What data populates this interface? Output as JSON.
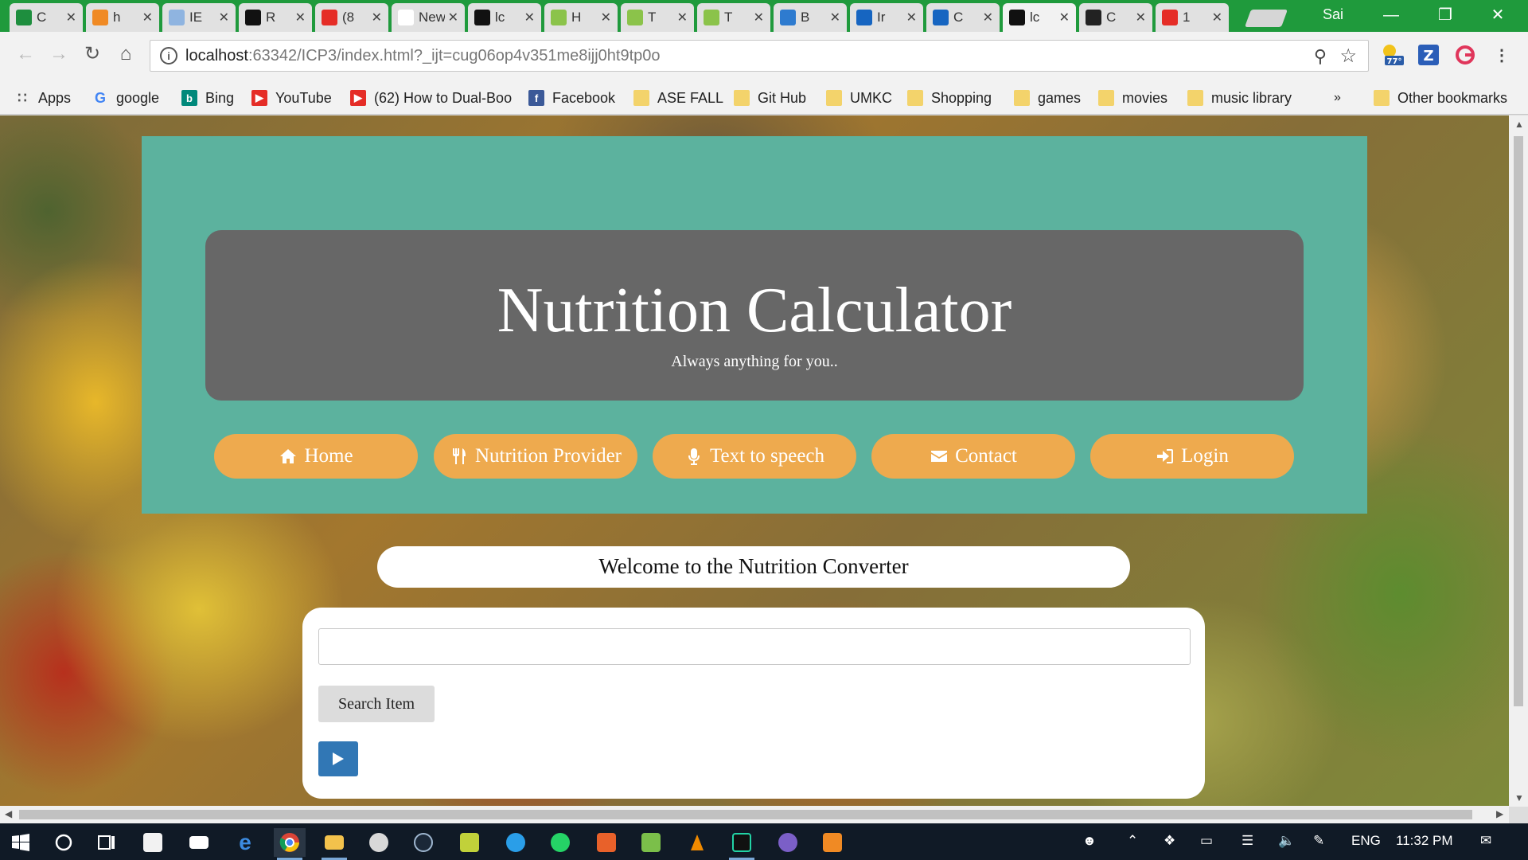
{
  "browser": {
    "tabs": [
      {
        "title": "C",
        "color": "#1e8e3e",
        "icon": "sheets-icon"
      },
      {
        "title": "h",
        "color": "#f08a24",
        "icon": "dots-icon"
      },
      {
        "title": "IE",
        "color": "#8fb4e0",
        "icon": "cloud-icon"
      },
      {
        "title": "R",
        "color": "#111111",
        "icon": "webstorm-icon"
      },
      {
        "title": "(8",
        "color": "#e52d27",
        "icon": "youtube-icon"
      },
      {
        "title": "New",
        "color": "#ffffff",
        "icon": "blank-icon"
      },
      {
        "title": "lc",
        "color": "#111111",
        "icon": "webstorm-icon"
      },
      {
        "title": "H",
        "color": "#8bc34a",
        "icon": "w3-icon"
      },
      {
        "title": "T",
        "color": "#8bc34a",
        "icon": "w3-icon"
      },
      {
        "title": "T",
        "color": "#8bc34a",
        "icon": "w3-icon"
      },
      {
        "title": "B",
        "color": "#2e7bcf",
        "icon": "bootstrap-icon"
      },
      {
        "title": "Ir",
        "color": "#1665c1",
        "icon": "box-icon"
      },
      {
        "title": "C",
        "color": "#1665c1",
        "icon": "box-icon"
      },
      {
        "title": "lc",
        "color": "#111111",
        "icon": "webstorm-icon"
      },
      {
        "title": "C",
        "color": "#222222",
        "icon": "github-icon"
      },
      {
        "title": "1",
        "color": "#e52d27",
        "icon": "youtube-icon"
      }
    ],
    "profile_name": "Sai",
    "url_host": "localhost",
    "url_rest": ":63342/ICP3/index.html?_ijt=cug06op4v351me8ijj0ht9tp0o",
    "weather_badge": "77°",
    "bookmarks": [
      {
        "label": "Apps",
        "icon": "apps-icon"
      },
      {
        "label": "google",
        "icon": "google-icon"
      },
      {
        "label": "Bing",
        "icon": "bing-icon"
      },
      {
        "label": "YouTube",
        "icon": "youtube-icon"
      },
      {
        "label": "(62) How to Dual-Boo",
        "icon": "youtube-icon"
      },
      {
        "label": "Facebook",
        "icon": "facebook-icon"
      },
      {
        "label": "ASE FALL",
        "icon": "folder-icon"
      },
      {
        "label": "Git Hub",
        "icon": "folder-icon"
      },
      {
        "label": "UMKC",
        "icon": "folder-icon"
      },
      {
        "label": "Shopping",
        "icon": "folder-icon"
      },
      {
        "label": "games",
        "icon": "folder-icon"
      },
      {
        "label": "movies",
        "icon": "folder-icon"
      },
      {
        "label": "music library",
        "icon": "folder-icon"
      }
    ],
    "overflow": "»",
    "other_bookmarks": "Other bookmarks"
  },
  "page": {
    "title": "Nutrition Calculator",
    "tagline": "Always anything for you..",
    "nav": [
      {
        "label": "Home",
        "icon": "home-icon"
      },
      {
        "label": "Nutrition Provider",
        "icon": "cutlery-icon"
      },
      {
        "label": "Text to speech",
        "icon": "microphone-icon"
      },
      {
        "label": "Contact",
        "icon": "envelope-icon"
      },
      {
        "label": "Login",
        "icon": "login-icon"
      }
    ],
    "welcome": "Welcome to the Nutrition Converter",
    "search": {
      "value": "",
      "placeholder": "",
      "button_label": "Search Item"
    },
    "colors": {
      "hero": "#5cb29e",
      "jumbotron": "#676767",
      "nav_pill": "#eeaa4e",
      "play_button": "#3177b5"
    }
  },
  "taskbar": {
    "language": "ENG",
    "time": "11:32 PM"
  }
}
